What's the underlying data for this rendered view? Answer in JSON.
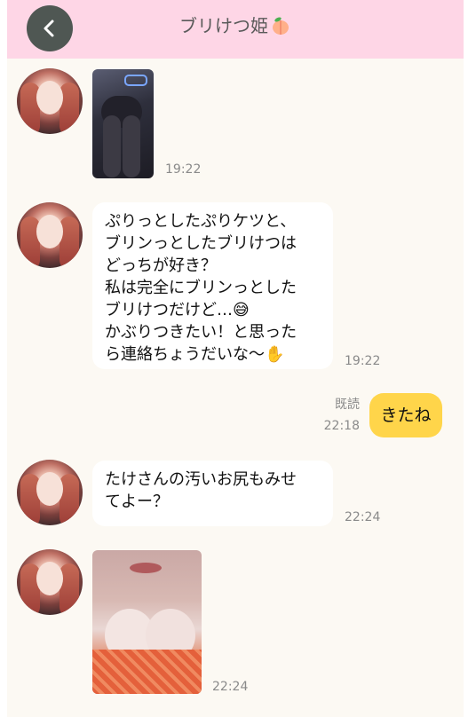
{
  "header": {
    "back_icon": "chevron-left-icon",
    "title": "ブリけつ姫",
    "title_emoji": "peach-icon"
  },
  "messages": [
    {
      "sender": "other",
      "type": "image",
      "time": "19:22"
    },
    {
      "sender": "other",
      "type": "text",
      "text": "ぷりっとしたぷりケツと、\nブリンっとしたブリけつは\nどっちが好き？\n私は完全にブリンっとした\nブリけつだけど…😅\nかぶりつきたい！と思った\nら連絡ちょうだいな〜✋",
      "time": "19:22"
    },
    {
      "sender": "me",
      "type": "text",
      "text": "きたね",
      "read_label": "既読",
      "time": "22:18"
    },
    {
      "sender": "other",
      "type": "text",
      "text": "たけさんの汚いお尻もみせ\nてよー？",
      "time": "22:24"
    },
    {
      "sender": "other",
      "type": "image",
      "time": "22:24"
    }
  ],
  "colors": {
    "header_bg": "#fed6e6",
    "chat_bg": "#fcf9f3",
    "my_bubble": "#ffd54a",
    "back_button": "#4f5753"
  }
}
